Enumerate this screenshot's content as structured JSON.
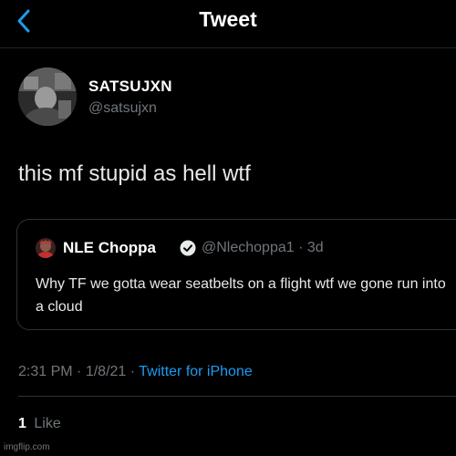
{
  "nav": {
    "title": "Tweet",
    "back_icon": "chevron-left-icon",
    "accent_color": "#1d9bf0"
  },
  "tweet": {
    "author": {
      "display_name": "SATSUJXN",
      "handle": "@satsujxn"
    },
    "text": "this mf stupid as hell wtf",
    "quoted": {
      "display_name": "NLE Choppa",
      "verified_icon": "verified-badge-icon",
      "handle": "@Nlechoppa1",
      "separator": "·",
      "age": "3d",
      "text": "Why TF we gotta wear seatbelts on a flight wtf we gone run into a cloud"
    },
    "time": "2:31 PM",
    "date": "1/8/21",
    "separator": "·",
    "source": "Twitter for iPhone",
    "likes_count": "1",
    "likes_label": "Like"
  },
  "watermark": "imgflip.com"
}
